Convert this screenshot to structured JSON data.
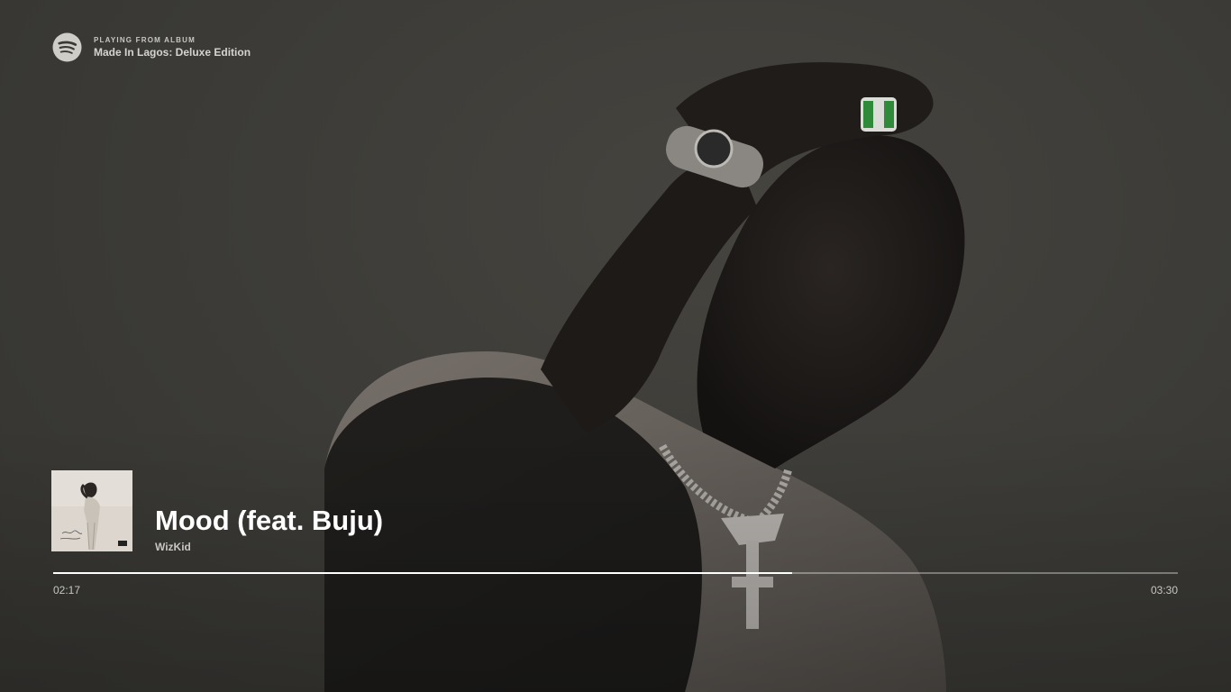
{
  "context": {
    "kicker": "PLAYING FROM ALBUM",
    "name": "Made In Lagos: Deluxe Edition",
    "logo_icon": "spotify-logo-icon"
  },
  "track": {
    "title": "Mood (feat. Buju)",
    "artist": "WizKid",
    "cover_icon": "album-cover"
  },
  "playback": {
    "elapsed": "02:17",
    "total": "03:30",
    "progress_fraction": 0.6571
  },
  "colors": {
    "background": "#3d3c38",
    "text_primary": "#ffffff",
    "text_secondary": "#c8c6c1",
    "progress_fill": "#ffffff"
  }
}
